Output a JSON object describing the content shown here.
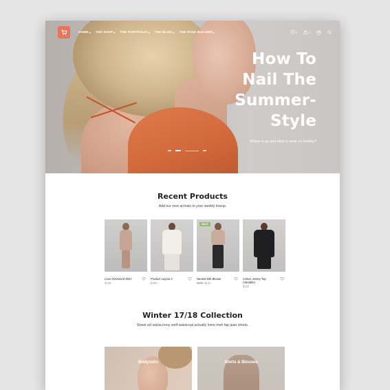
{
  "nav": {
    "menu": [
      {
        "label": "HOME"
      },
      {
        "label": "THE SHOP"
      },
      {
        "label": "THE PORTFOLIO"
      },
      {
        "label": "THE BLOG"
      },
      {
        "label": "THE PAGE BUILDER"
      }
    ],
    "wishlist_count": "0",
    "cart_count": "0"
  },
  "hero": {
    "title_lines": [
      "How To",
      "Nail The",
      "Summer-",
      "Style"
    ],
    "subtitle": "Where to go and what to wear on holiday?",
    "slides": 3,
    "active_slide": 2
  },
  "recent_products": {
    "title": "Recent Products",
    "subtitle": "Add our new arrivals to your weekly lineup.",
    "items": [
      {
        "name": "Luxe Oversized Shirt",
        "price": "$236",
        "old_price": "",
        "sale": false
      },
      {
        "name": "Product Layout 4",
        "price": "$360",
        "old_price": "",
        "sale": false
      },
      {
        "name": "Neutral Silk Blouse",
        "price": "$130",
        "old_price": "$188",
        "sale": true,
        "sale_label": "SALE"
      },
      {
        "name": "Cotton Jersey Top (Variable)",
        "price": "$105",
        "old_price": "",
        "sale": false
      }
    ]
  },
  "collection": {
    "title": "Winter 17/18 Collection",
    "subtitle": "Street art salvia irony wolf waistcoat actually lomo meh fap jean shorts.",
    "categories": [
      {
        "label": "Bodysuits"
      },
      {
        "label": "Shirts & Blouses"
      }
    ]
  },
  "colors": {
    "accent": "#e8755a",
    "sale": "#8fbf6a",
    "dress": "#d0683b"
  }
}
